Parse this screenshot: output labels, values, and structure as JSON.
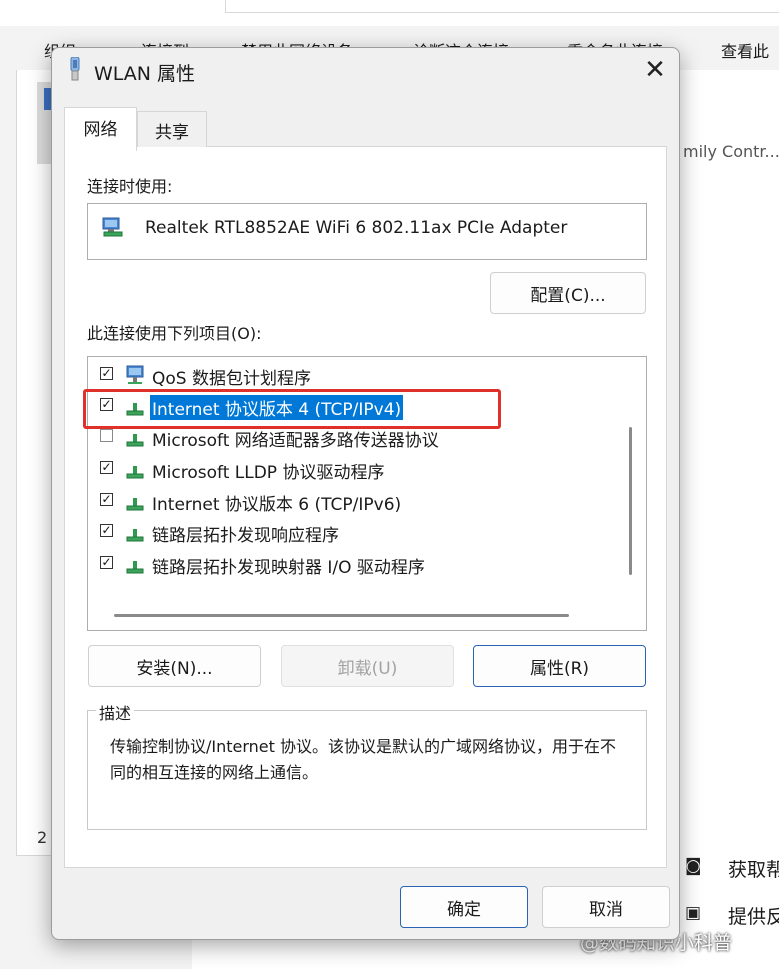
{
  "background": {
    "command_bar": [
      "组织 ▾",
      "连接到",
      "禁用此网络设备",
      "诊断这个连接",
      "重命名此连接",
      "查看此"
    ],
    "side_text": "mily Contr...",
    "left_count": "2",
    "lower_items": [
      {
        "icon": "help-icon",
        "label": "获取帮"
      },
      {
        "icon": "feedback-icon",
        "label": "提供反"
      }
    ],
    "watermark": "@数码知识小科普"
  },
  "dialog": {
    "title": "WLAN 属性",
    "tabs": [
      {
        "label": "网络",
        "active": true
      },
      {
        "label": "共享",
        "active": false
      }
    ],
    "connect_using_label": "连接时使用:",
    "adapter_name": "Realtek RTL8852AE WiFi 6 802.11ax PCIe Adapter",
    "configure_button": "配置(C)...",
    "items_label": "此连接使用下列项目(O):",
    "items": [
      {
        "label": "QoS 数据包计划程序",
        "checked": true,
        "icon": "qos-icon"
      },
      {
        "label": "Internet 协议版本 4 (TCP/IPv4)",
        "checked": true,
        "icon": "protocol-icon",
        "selected": true
      },
      {
        "label": "Microsoft 网络适配器多路传送器协议",
        "checked": false,
        "icon": "protocol-icon"
      },
      {
        "label": "Microsoft LLDP 协议驱动程序",
        "checked": true,
        "icon": "protocol-icon"
      },
      {
        "label": "Internet 协议版本 6 (TCP/IPv6)",
        "checked": true,
        "icon": "protocol-icon"
      },
      {
        "label": "链路层拓扑发现响应程序",
        "checked": true,
        "icon": "protocol-icon"
      },
      {
        "label": "链路层拓扑发现映射器 I/O 驱动程序",
        "checked": true,
        "icon": "protocol-icon"
      }
    ],
    "install_button": "安装(N)...",
    "uninstall_button": "卸载(U)",
    "properties_button": "属性(R)",
    "description_legend": "描述",
    "description_text": "传输控制协议/Internet 协议。该协议是默认的广域网络协议，用于在不同的相互连接的网络上通信。",
    "ok_button": "确定",
    "cancel_button": "取消",
    "colors": {
      "selection": "#0078d7",
      "annotation": "#e0302a"
    }
  }
}
